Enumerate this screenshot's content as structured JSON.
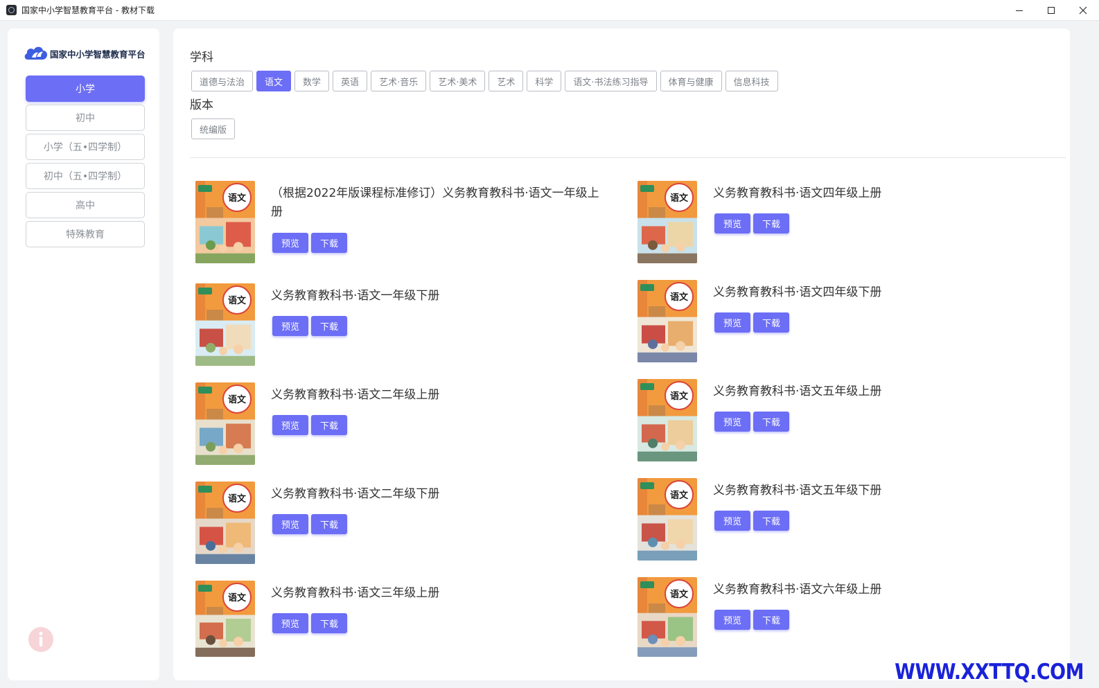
{
  "window": {
    "title": "国家中小学智慧教育平台 - 教材下载",
    "minimize_icon": "minimize-icon",
    "maximize_icon": "maximize-icon",
    "close_icon": "close-icon"
  },
  "sidebar": {
    "logo_text": "国家中小学智慧教育平台",
    "levels": [
      {
        "label": "小学",
        "active": true
      },
      {
        "label": "初中",
        "active": false
      },
      {
        "label": "小学（五•四学制）",
        "active": false
      },
      {
        "label": "初中（五•四学制）",
        "active": false
      },
      {
        "label": "高中",
        "active": false
      },
      {
        "label": "特殊教育",
        "active": false
      }
    ],
    "info_icon": "info-icon"
  },
  "filters": {
    "subject_label": "学科",
    "subjects": [
      {
        "label": "道德与法治",
        "active": false
      },
      {
        "label": "语文",
        "active": true
      },
      {
        "label": "数学",
        "active": false
      },
      {
        "label": "英语",
        "active": false
      },
      {
        "label": "艺术·音乐",
        "active": false
      },
      {
        "label": "艺术·美术",
        "active": false
      },
      {
        "label": "艺术",
        "active": false
      },
      {
        "label": "科学",
        "active": false
      },
      {
        "label": "语文·书法练习指导",
        "active": false
      },
      {
        "label": "体育与健康",
        "active": false
      },
      {
        "label": "信息科技",
        "active": false
      }
    ],
    "edition_label": "版本",
    "editions": [
      {
        "label": "统编版",
        "active": false
      }
    ]
  },
  "actions": {
    "preview": "预览",
    "download": "下载"
  },
  "books": [
    {
      "title": "（根据2022年版课程标准修订）义务教育教科书·语文一年级上册",
      "grade_tag": "一年级上册"
    },
    {
      "title": "义务教育教科书·语文四年级上册",
      "grade_tag": "四年级上册"
    },
    {
      "title": "义务教育教科书·语文一年级下册",
      "grade_tag": "一年级下册"
    },
    {
      "title": "义务教育教科书·语文四年级下册",
      "grade_tag": "四年级下册"
    },
    {
      "title": "义务教育教科书·语文二年级上册",
      "grade_tag": "二年级上册"
    },
    {
      "title": "义务教育教科书·语文五年级上册",
      "grade_tag": "五年级上册"
    },
    {
      "title": "义务教育教科书·语文二年级下册",
      "grade_tag": "二年级下册"
    },
    {
      "title": "义务教育教科书·语文五年级下册",
      "grade_tag": "五年级下册"
    },
    {
      "title": "义务教育教科书·语文三年级上册",
      "grade_tag": "三年级上册"
    },
    {
      "title": "义务教育教科书·语文六年级上册",
      "grade_tag": "六年级上册"
    }
  ],
  "cover_glyph": "语文",
  "watermark": "WWW.XXTTQ.COM"
}
